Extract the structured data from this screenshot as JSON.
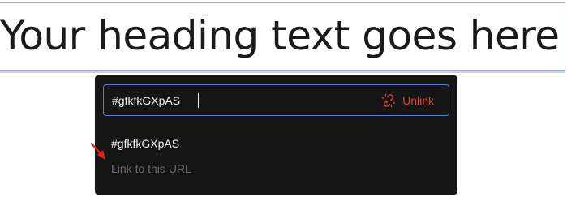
{
  "heading": {
    "text": "Your heading text goes here"
  },
  "link_popover": {
    "input_value": "#gfkfkGXpAS",
    "unlink_label": "Unlink",
    "unlink_icon": "broken-link-icon",
    "suggestion": {
      "title": "#gfkfkGXpAS",
      "subtitle": "Link to this URL"
    }
  },
  "colors": {
    "popover_bg": "#151515",
    "input_border": "#5c7bd6",
    "unlink_red": "#e0463a",
    "arrow_red": "#e8201c"
  }
}
